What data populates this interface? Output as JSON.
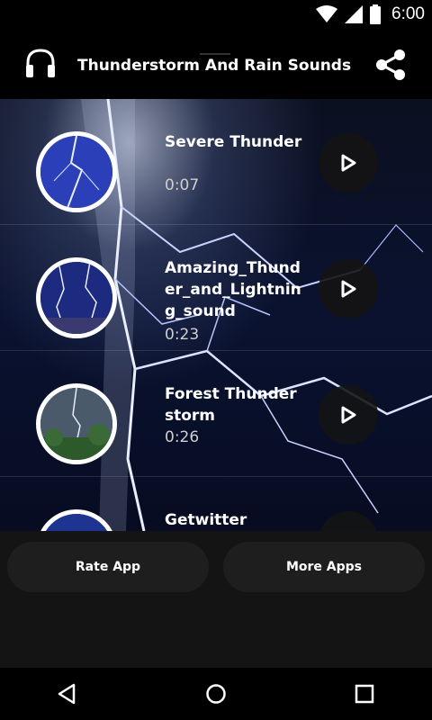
{
  "status_bar": {
    "time": "6:00",
    "icons": [
      "wifi-icon",
      "cellular-icon",
      "battery-icon"
    ]
  },
  "app_bar": {
    "title": "Thunderstorm And Rain Sounds",
    "left_icon": "headphones-icon",
    "right_icon": "share-icon"
  },
  "tracks": [
    {
      "title": "Severe Thunder",
      "duration": "0:07"
    },
    {
      "title": "Amazing_Thunder_and_Lightning_sound",
      "duration": "0:23"
    },
    {
      "title": "Forest Thunder storm",
      "duration": "0:26"
    },
    {
      "title": "Getwitter",
      "duration": ""
    }
  ],
  "bottom_buttons": {
    "rate_label": "Rate App",
    "more_label": "More Apps"
  },
  "nav": [
    "back-icon",
    "home-icon",
    "recents-icon"
  ],
  "colors": {
    "background": "#000000",
    "panel": "#141414",
    "pill": "#1e1e1e",
    "accent": "#ffffff"
  }
}
